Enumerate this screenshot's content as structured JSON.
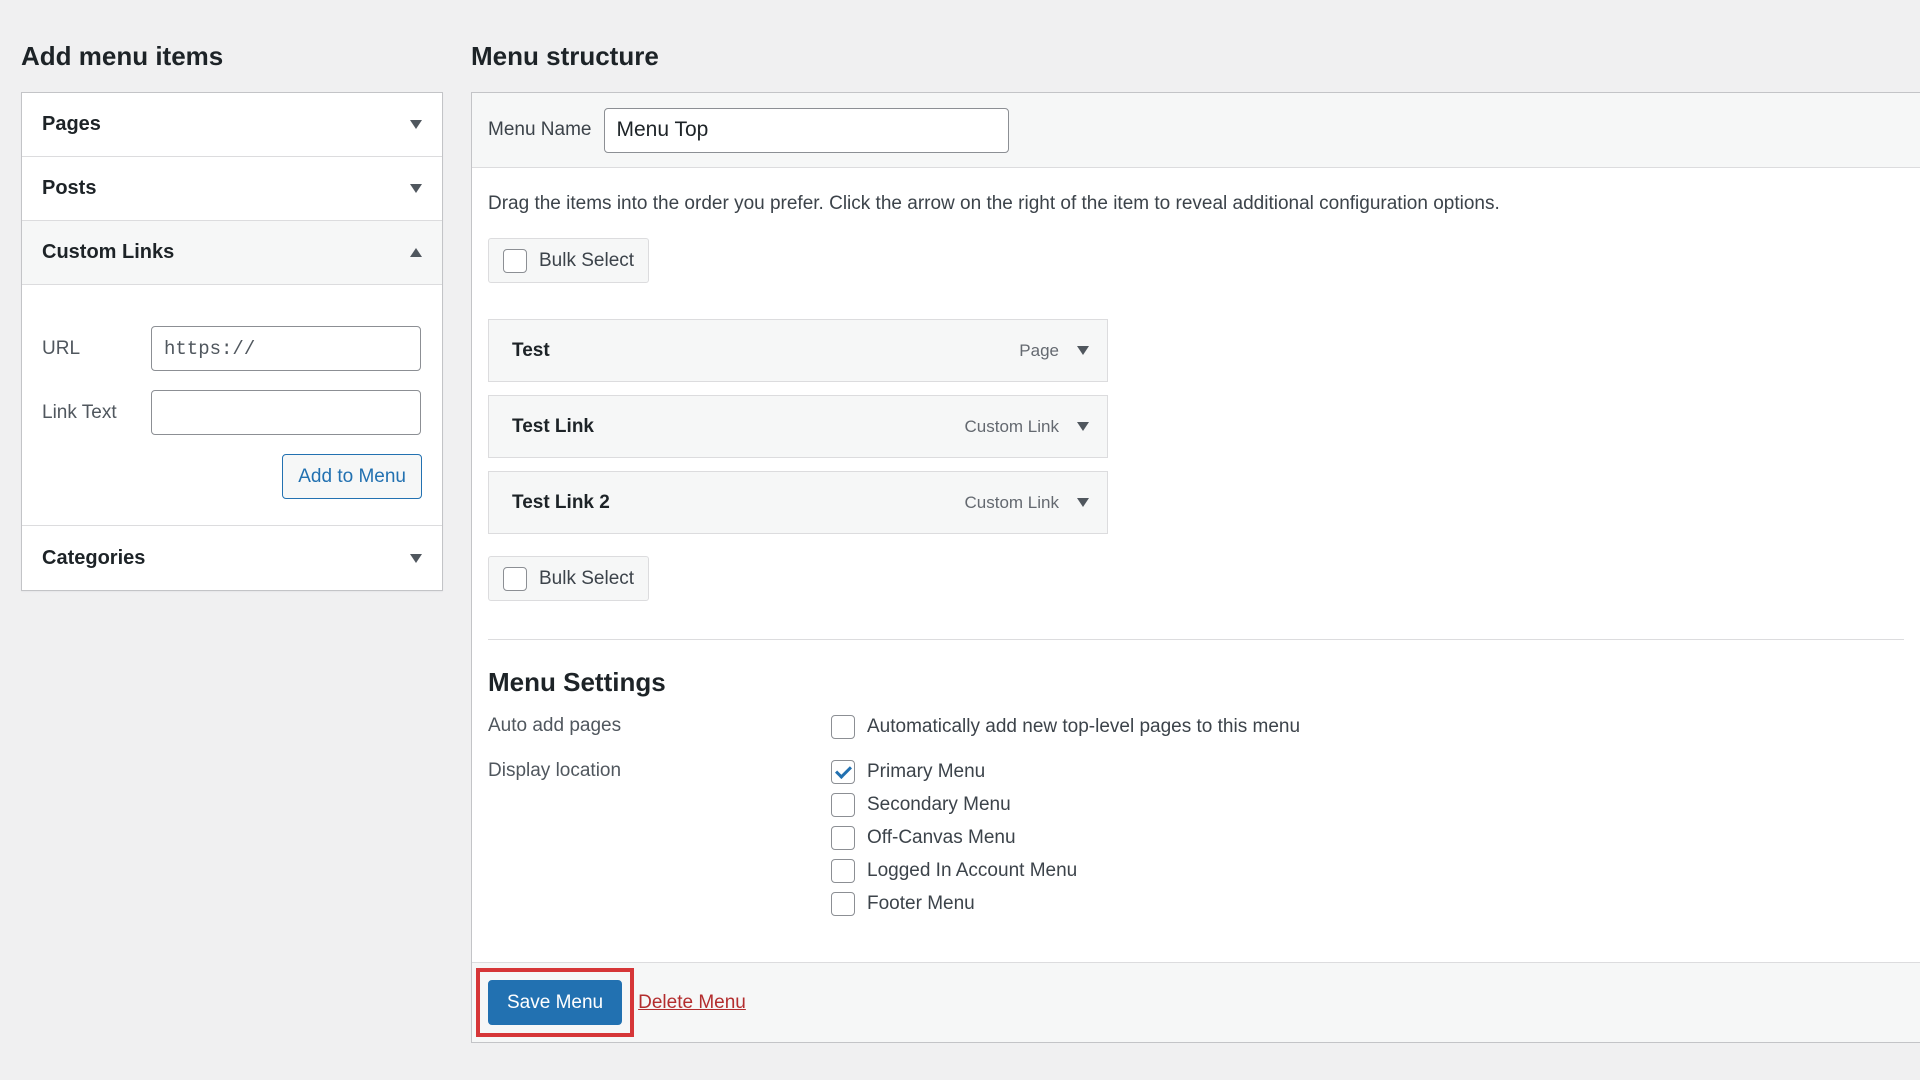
{
  "left": {
    "title": "Add menu items",
    "sections": {
      "pages": "Pages",
      "posts": "Posts",
      "custom_links": "Custom Links",
      "categories": "Categories"
    },
    "custom_links": {
      "url_label": "URL",
      "url_value": "https://",
      "link_text_label": "Link Text",
      "link_text_value": "",
      "add_button": "Add to Menu"
    }
  },
  "right": {
    "title": "Menu structure",
    "menu_name_label": "Menu Name",
    "menu_name_value": "Menu Top",
    "instructions": "Drag the items into the order you prefer. Click the arrow on the right of the item to reveal additional configuration options.",
    "bulk_select": "Bulk Select",
    "items": [
      {
        "title": "Test",
        "type": "Page"
      },
      {
        "title": "Test Link",
        "type": "Custom Link"
      },
      {
        "title": "Test Link 2",
        "type": "Custom Link"
      }
    ],
    "settings": {
      "title": "Menu Settings",
      "auto_add_label": "Auto add pages",
      "auto_add_option": "Automatically add new top-level pages to this menu",
      "auto_add_checked": false,
      "display_location_label": "Display location",
      "locations": [
        {
          "label": "Primary Menu",
          "checked": true
        },
        {
          "label": "Secondary Menu",
          "checked": false
        },
        {
          "label": "Off-Canvas Menu",
          "checked": false
        },
        {
          "label": "Logged In Account Menu",
          "checked": false
        },
        {
          "label": "Footer Menu",
          "checked": false
        }
      ]
    },
    "save_button": "Save Menu",
    "delete_link": "Delete Menu"
  },
  "colors": {
    "primary": "#2271b1",
    "danger": "#b32d2e",
    "highlight": "#d63638"
  }
}
